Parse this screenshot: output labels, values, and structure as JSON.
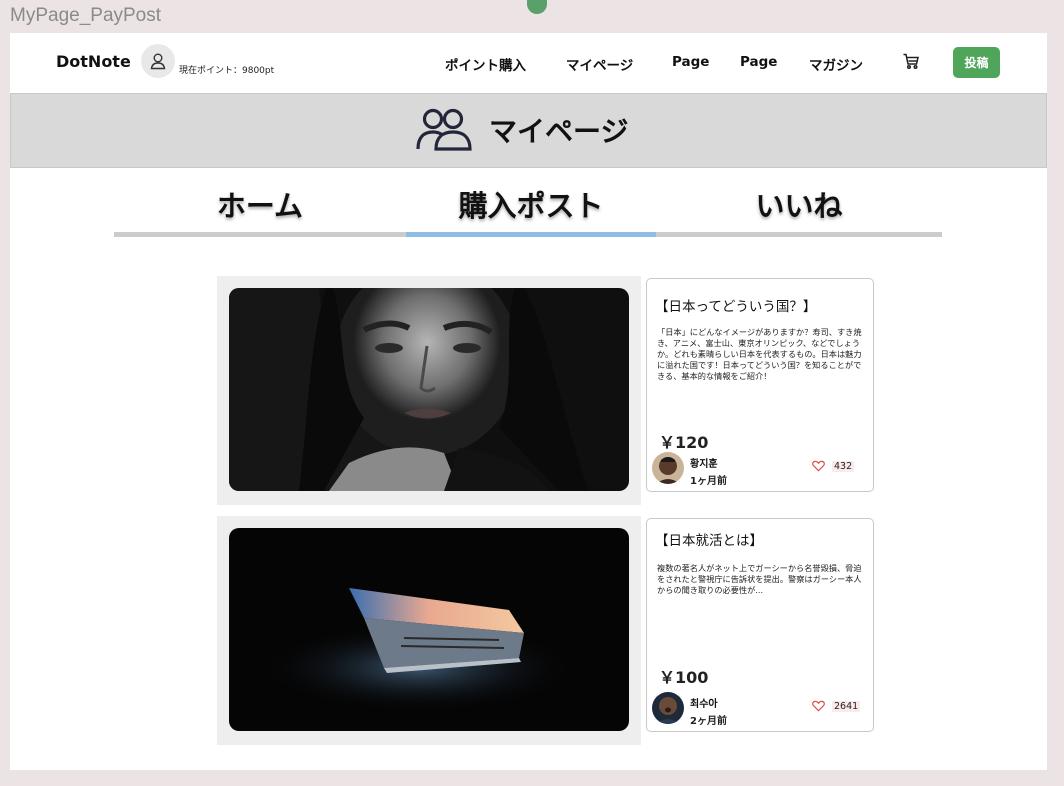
{
  "frame_label": "MyPage_PayPost",
  "header": {
    "logo": "DotNote",
    "points": "現在ポイント：9800pt",
    "nav": [
      "ポイント購入",
      "マイページ",
      "Page",
      "Page",
      "マガジン"
    ],
    "post_button": "投稿"
  },
  "banner": {
    "title": "マイページ"
  },
  "tabs": [
    {
      "label": "ホーム",
      "active": false
    },
    {
      "label": "購入ポスト",
      "active": true
    },
    {
      "label": "いいね",
      "active": false
    }
  ],
  "posts": [
    {
      "title": "【日本ってどういう国？】",
      "description": "「日本」にどんなイメージがありますか？寿司、すき焼き、アニメ、富士山、東京オリンピック、などでしょうか。どれも素晴らしい日本を代表するもの。日本は魅力に溢れた国です！日本ってどういう国？を知ることができる、基本的な情報をご紹介！",
      "price": "￥120",
      "author": "황지훈",
      "time": "1ヶ月前",
      "likes": "432"
    },
    {
      "title": "【日本就活とは】",
      "description": "複数の著名人がネット上でガーシーから名誉毀損、脅迫をされたと警視庁に告訴状を提出。警察はガーシー本人からの聞き取りの必要性が...",
      "price": "￥100",
      "author": "최수아",
      "time": "2ヶ月前",
      "likes": "2641"
    }
  ],
  "colors": {
    "accent_green": "#4fa55a",
    "active_tab": "#8fbde8",
    "banner_bg": "#d9d9d9",
    "like_red": "#e04a4a"
  },
  "icons": [
    "user-icon",
    "cart-icon",
    "users-icon",
    "heart-icon"
  ]
}
